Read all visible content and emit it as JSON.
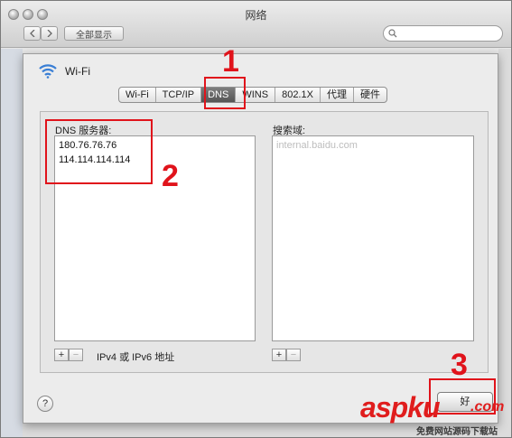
{
  "window": {
    "title": "网络"
  },
  "toolbar": {
    "show_all_label": "全部显示",
    "search_placeholder": ""
  },
  "sheet": {
    "interface_name": "Wi-Fi",
    "tabs": [
      {
        "label": "Wi-Fi"
      },
      {
        "label": "TCP/IP"
      },
      {
        "label": "DNS"
      },
      {
        "label": "WINS"
      },
      {
        "label": "802.1X"
      },
      {
        "label": "代理"
      },
      {
        "label": "硬件"
      }
    ],
    "active_tab": "DNS",
    "dns_servers_label": "DNS 服务器:",
    "dns_servers": [
      "180.76.76.76",
      "114.114.114.114"
    ],
    "search_domains_label": "搜索域:",
    "search_domains": [
      "internal.baidu.com"
    ],
    "address_hint": "IPv4 或 IPv6 地址",
    "add_label": "+",
    "remove_label": "−",
    "help_label": "?",
    "ok_label": "好"
  },
  "annotations": {
    "step1": "1",
    "step2": "2",
    "step3": "3"
  },
  "watermark": {
    "brand": "aspku",
    "suffix": ".com",
    "tagline": "免费网站源码下载站"
  },
  "colors": {
    "annotation_red": "#e0131b",
    "active_tab": "#5f5f5f"
  }
}
